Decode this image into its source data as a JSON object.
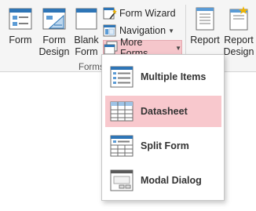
{
  "ribbon": {
    "buttons": {
      "form": "Form",
      "form_design": "Form\nDesign",
      "blank_form": "Blank\nForm",
      "report": "Report",
      "report_design": "Report\nDesign"
    },
    "small_buttons": {
      "form_wizard": "Form Wizard",
      "navigation": "Navigation",
      "more_forms": "More Forms"
    },
    "group_label": "Forms",
    "accent_color": "#f5c6cb"
  },
  "menu": {
    "items": [
      {
        "label": "Multiple Items",
        "icon": "multiple-items-icon"
      },
      {
        "label": "Datasheet",
        "icon": "datasheet-icon",
        "highlighted": true
      },
      {
        "label": "Split Form",
        "icon": "split-form-icon"
      },
      {
        "label": "Modal Dialog",
        "icon": "modal-dialog-icon"
      }
    ]
  }
}
